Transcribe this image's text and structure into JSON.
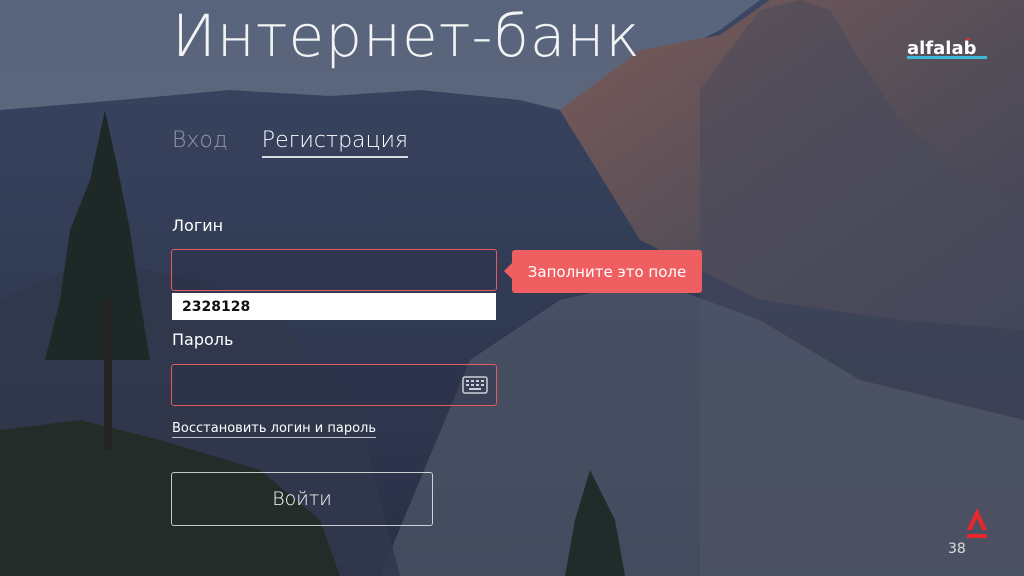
{
  "header": {
    "title": "Интернет-банк"
  },
  "logo": {
    "text": "alfalab",
    "accent": "#e8272a"
  },
  "tabs": [
    {
      "label": "Вход",
      "active": false
    },
    {
      "label": "Регистрация",
      "active": true
    }
  ],
  "form": {
    "login_label": "Логин",
    "login_value": "",
    "autocomplete_suggestion": "2328128",
    "tooltip_text": "Заполните это поле",
    "password_label": "Пароль",
    "password_value": "",
    "keyboard_icon": "keyboard-icon",
    "restore_link": "Восстановить логин и пароль",
    "submit_label": "Войти"
  },
  "footer": {
    "page_number": "38",
    "bank_logo": "alfa-bank-logo"
  },
  "colors": {
    "error": "#e8595d",
    "tooltip": "#ef5e61",
    "brand_red": "#e8272a"
  }
}
